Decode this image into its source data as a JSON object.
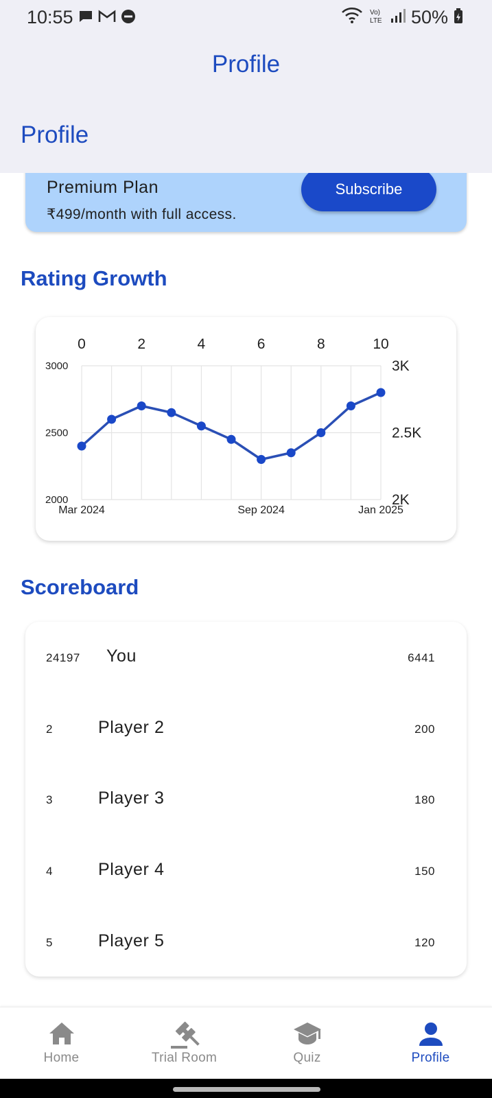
{
  "status_bar": {
    "time": "10:55",
    "battery": "50%",
    "left_icons": [
      "chat-bubble-icon",
      "gmail-icon",
      "do-not-disturb-icon"
    ],
    "right_icons": [
      "wifi-icon",
      "volte-icon",
      "signal-icon",
      "battery-icon"
    ]
  },
  "app_bar": {
    "title": "Profile",
    "subtitle": "Profile"
  },
  "premium": {
    "title": "Premium Plan",
    "price": "₹499/month with full access.",
    "subscribe_label": "Subscribe"
  },
  "rating_section": {
    "heading": "Rating Growth"
  },
  "chart_data": {
    "type": "line",
    "x": [
      0,
      1,
      2,
      3,
      4,
      5,
      6,
      7,
      8,
      9,
      10
    ],
    "series": [
      {
        "values": [
          2400,
          2600,
          2700,
          2650,
          2550,
          2450,
          2300,
          2350,
          2500,
          2700,
          2800
        ]
      }
    ],
    "xlim": [
      0,
      10
    ],
    "ylim": [
      2000,
      3000
    ],
    "x_tick_labels_top": [
      "0",
      "2",
      "4",
      "6",
      "8",
      "10"
    ],
    "y_tick_labels_left": [
      "3000",
      "2500",
      "2000"
    ],
    "y_tick_labels_right": [
      "3K",
      "2.5K",
      "2K"
    ],
    "x_date_labels_bottom": [
      "Mar 2024",
      "Sep 2024",
      "Jan 2025"
    ],
    "grid": true,
    "line_color": "#2a4fb5",
    "point_color": "#1a48c8"
  },
  "scoreboard": {
    "heading": "Scoreboard",
    "rows": [
      {
        "rank": "24197",
        "name": "You",
        "score": "6441"
      },
      {
        "rank": "2",
        "name": "Player 2",
        "score": "200"
      },
      {
        "rank": "3",
        "name": "Player 3",
        "score": "180"
      },
      {
        "rank": "4",
        "name": "Player 4",
        "score": "150"
      },
      {
        "rank": "5",
        "name": "Player 5",
        "score": "120"
      }
    ]
  },
  "bottom_nav": {
    "items": [
      {
        "label": "Home",
        "icon": "home-icon",
        "active": false
      },
      {
        "label": "Trial Room",
        "icon": "gavel-icon",
        "active": false
      },
      {
        "label": "Quiz",
        "icon": "graduation-cap-icon",
        "active": false
      },
      {
        "label": "Profile",
        "icon": "person-icon",
        "active": true
      }
    ]
  },
  "colors": {
    "accent": "#1d4bbf",
    "button": "#1a49c9",
    "premium_card": "#aed3fc",
    "app_bar_bg": "#efeff6",
    "inactive_nav": "#8a8a8a"
  }
}
